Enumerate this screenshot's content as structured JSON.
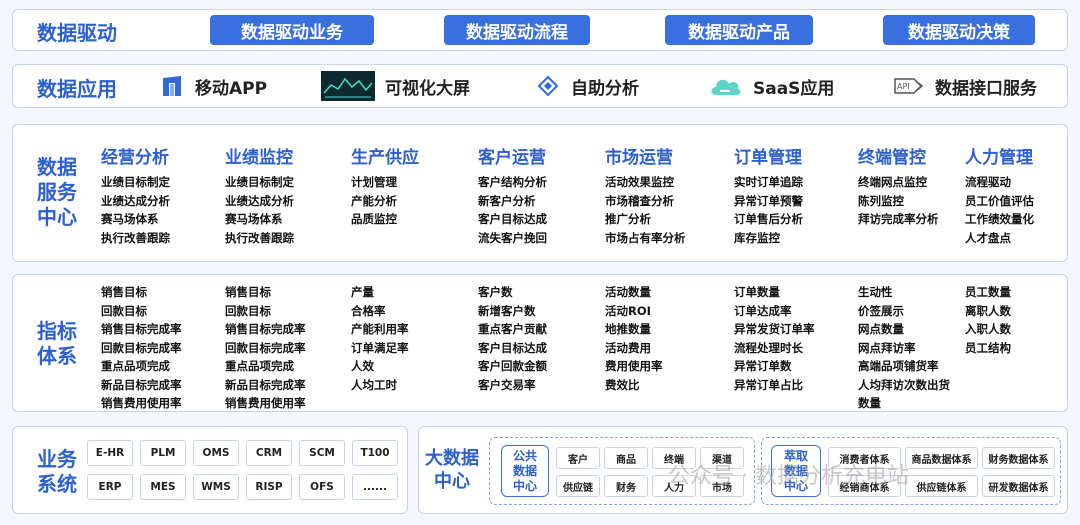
{
  "drive": {
    "title": "数据驱动",
    "items": [
      "数据驱动业务",
      "数据驱动流程",
      "数据驱动产品",
      "数据驱动决策"
    ]
  },
  "apps": {
    "title": "数据应用",
    "items": [
      {
        "icon": "mobile-app-icon",
        "label": "移动APP"
      },
      {
        "icon": "dashboard-screen-icon",
        "label": "可视化大屏"
      },
      {
        "icon": "self-analysis-icon",
        "label": "自助分析"
      },
      {
        "icon": "cloud-icon",
        "label": "SaaS应用"
      },
      {
        "icon": "api-icon",
        "label": "数据接口服务"
      }
    ]
  },
  "service": {
    "title_lines": [
      "数据",
      "服务",
      "中心"
    ],
    "columns": [
      {
        "head": "经营分析",
        "items": [
          "业绩目标制定",
          "业绩达成分析",
          "赛马场体系",
          "执行改善跟踪"
        ]
      },
      {
        "head": "业绩监控",
        "items": [
          "业绩目标制定",
          "业绩达成分析",
          "赛马场体系",
          "执行改善跟踪"
        ]
      },
      {
        "head": "生产供应",
        "items": [
          "计划管理",
          "产能分析",
          "品质监控"
        ]
      },
      {
        "head": "客户运营",
        "items": [
          "客户结构分析",
          "新客户分析",
          "客户目标达成",
          "流失客户挽回"
        ]
      },
      {
        "head": "市场运营",
        "items": [
          "活动效果监控",
          "市场稽查分析",
          "推广分析",
          "市场占有率分析"
        ]
      },
      {
        "head": "订单管理",
        "items": [
          "实时订单追踪",
          "异常订单预警",
          "订单售后分析",
          "库存监控"
        ]
      },
      {
        "head": "终端管控",
        "items": [
          "终端网点监控",
          "陈列监控",
          "拜访完成率分析"
        ]
      },
      {
        "head": "人力管理",
        "items": [
          "流程驱动",
          "员工价值评估",
          "工作绩效量化",
          "人才盘点"
        ]
      }
    ]
  },
  "metrics": {
    "title_lines": [
      "指标",
      "体系"
    ],
    "columns": [
      [
        "销售目标",
        "回款目标",
        "销售目标完成率",
        "回款目标完成率",
        "重点品项完成",
        "新品目标完成率",
        "销售费用使用率"
      ],
      [
        "销售目标",
        "回款目标",
        "销售目标完成率",
        "回款目标完成率",
        "重点品项完成",
        "新品目标完成率",
        "销售费用使用率"
      ],
      [
        "产量",
        "合格率",
        "产能利用率",
        "订单满足率",
        "人效",
        "人均工时"
      ],
      [
        "客户数",
        "新增客户数",
        "重点客户贡献",
        "客户目标达成",
        "客户回款金额",
        "客户交易率"
      ],
      [
        "活动数量",
        "活动ROI",
        "地推数量",
        "活动费用",
        "费用使用率",
        "费效比"
      ],
      [
        "订单数量",
        "订单达成率",
        "异常发货订单率",
        "流程处理时长",
        "异常订单数",
        "异常订单占比"
      ],
      [
        "生动性",
        "价签展示",
        "网点数量",
        "网点拜访率",
        "高端品项铺货率",
        "人均拜访次数出货",
        "数量"
      ],
      [
        "员工数量",
        "离职人数",
        "入职人数",
        "员工结构"
      ]
    ]
  },
  "business": {
    "title_lines": [
      "业务",
      "系统"
    ],
    "systems": [
      "E-HR",
      "PLM",
      "OMS",
      "CRM",
      "SCM",
      "T100",
      "ERP",
      "MES",
      "WMS",
      "RISP",
      "OFS",
      "......"
    ]
  },
  "bigdata": {
    "title_lines": [
      "大数据",
      "中心"
    ],
    "hub1_lines": [
      "公共",
      "数据",
      "中心"
    ],
    "hub1_tags": [
      "客户",
      "商品",
      "终端",
      "渠道",
      "供应链",
      "财务",
      "人力",
      "市场"
    ],
    "hub2_lines": [
      "萃取",
      "数据",
      "中心"
    ],
    "hub2_tags": [
      "消费者体系",
      "商品数据体系",
      "财务数据体系",
      "经销商体系",
      "供应链体系",
      "研发数据体系"
    ]
  },
  "watermark": "公众号 · 数据分析充电站"
}
